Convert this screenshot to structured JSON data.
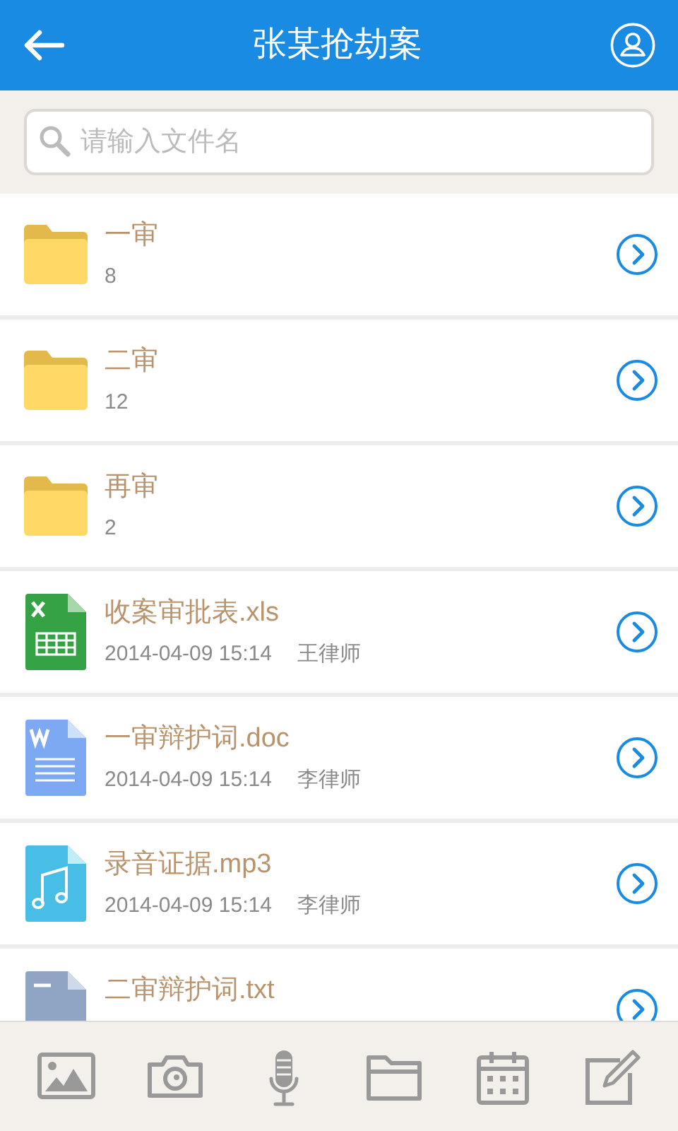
{
  "header": {
    "title": "张某抢劫案"
  },
  "search": {
    "placeholder": "请输入文件名"
  },
  "files": [
    {
      "kind": "folder",
      "name": "一审",
      "count": "8"
    },
    {
      "kind": "folder",
      "name": "二审",
      "count": "12"
    },
    {
      "kind": "folder",
      "name": "再审",
      "count": "2"
    },
    {
      "kind": "xls",
      "name": "收案审批表.xls",
      "date": "2014-04-09 15:14",
      "author": "王律师"
    },
    {
      "kind": "doc",
      "name": "一审辩护词.doc",
      "date": "2014-04-09 15:14",
      "author": "李律师"
    },
    {
      "kind": "mp3",
      "name": "录音证据.mp3",
      "date": "2014-04-09 15:14",
      "author": "李律师"
    },
    {
      "kind": "txt",
      "name": "二审辩护词.txt"
    }
  ],
  "toolbar": [
    {
      "kind": "image"
    },
    {
      "kind": "camera"
    },
    {
      "kind": "microphone"
    },
    {
      "kind": "folder"
    },
    {
      "kind": "calendar"
    },
    {
      "kind": "edit"
    }
  ]
}
